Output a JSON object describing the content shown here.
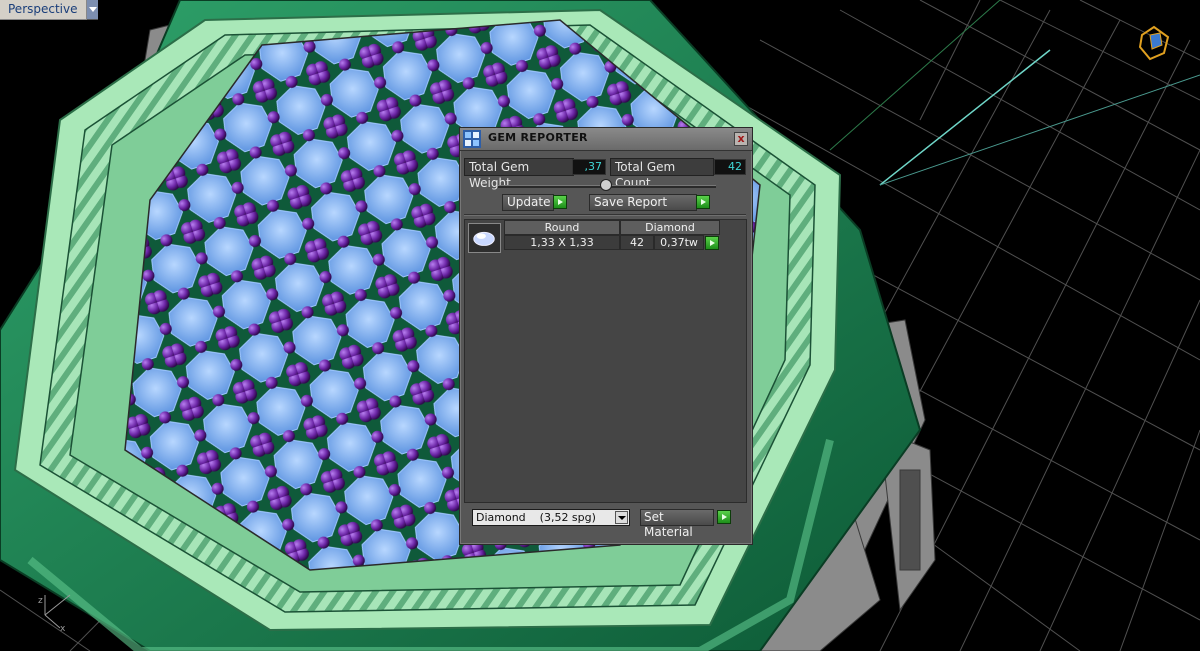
{
  "viewport": {
    "name": "Perspective",
    "axis_labels": {
      "z": "z",
      "x": "x"
    }
  },
  "scene": {
    "description_colors": {
      "background": "#000000",
      "grid": "#555555",
      "metal": "#1f8a5a",
      "metal_highlight": "#a9e8b8",
      "gem": "#7bb0f5",
      "prong": "#5a1b8c"
    }
  },
  "gem_reporter": {
    "title": "GEM REPORTER",
    "total_gem_weight_label": "Total Gem Weight",
    "total_gem_weight_value": ",37",
    "total_gem_count_label": "Total Gem Count",
    "total_gem_count_value": "42",
    "update_label": "Update",
    "save_report_label": "Save Report",
    "table": {
      "shape_header": "Round",
      "material_header": "Diamond",
      "size": "1,33 X 1,33",
      "count": "42",
      "weight": "0,37tw"
    },
    "material_select": "Diamond    (3,52 spg)",
    "set_material_label": "Set Material",
    "accent_color": "#2aa52a",
    "value_color": "#3fd7d7"
  }
}
